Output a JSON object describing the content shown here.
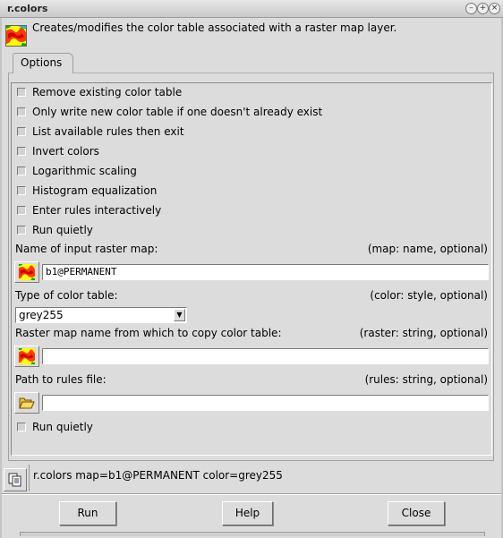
{
  "window": {
    "title": "r.colors"
  },
  "header": {
    "description": "Creates/modifies the color table associated with a raster map layer."
  },
  "tabs": [
    {
      "label": "Options"
    }
  ],
  "checkboxes": [
    {
      "label": "Remove existing color table",
      "checked": false
    },
    {
      "label": "Only write new color table if one doesn't already exist",
      "checked": false
    },
    {
      "label": "List available rules then exit",
      "checked": false
    },
    {
      "label": "Invert colors",
      "checked": false
    },
    {
      "label": "Logarithmic scaling",
      "checked": false
    },
    {
      "label": "Histogram equalization",
      "checked": false
    },
    {
      "label": "Enter rules interactively",
      "checked": false
    },
    {
      "label": "Run quietly",
      "checked": false
    }
  ],
  "fields": {
    "input_map": {
      "label": "Name of input raster map:",
      "hint": "(map:  name, optional)",
      "value": "b1@PERMANENT"
    },
    "color_type": {
      "label": "Type of color table:",
      "hint": "(color:  style, optional)",
      "value": "grey255"
    },
    "copy_raster": {
      "label": "Raster map name from which to copy color table:",
      "hint": "(raster:  string, optional)",
      "value": ""
    },
    "rules_file": {
      "label": "Path to rules file:",
      "hint": "(rules:  string, optional)",
      "value": ""
    }
  },
  "bottom_checkbox": {
    "label": "Run quietly",
    "checked": false
  },
  "command": {
    "text": "r.colors map=b1@PERMANENT color=grey255"
  },
  "buttons": {
    "run": "Run",
    "help": "Help",
    "close": "Close"
  },
  "icons": {
    "module": "raster-map-icon",
    "raster_select": "raster-map-icon",
    "file_open": "folder-open-icon",
    "copy": "copy-command-icon"
  }
}
